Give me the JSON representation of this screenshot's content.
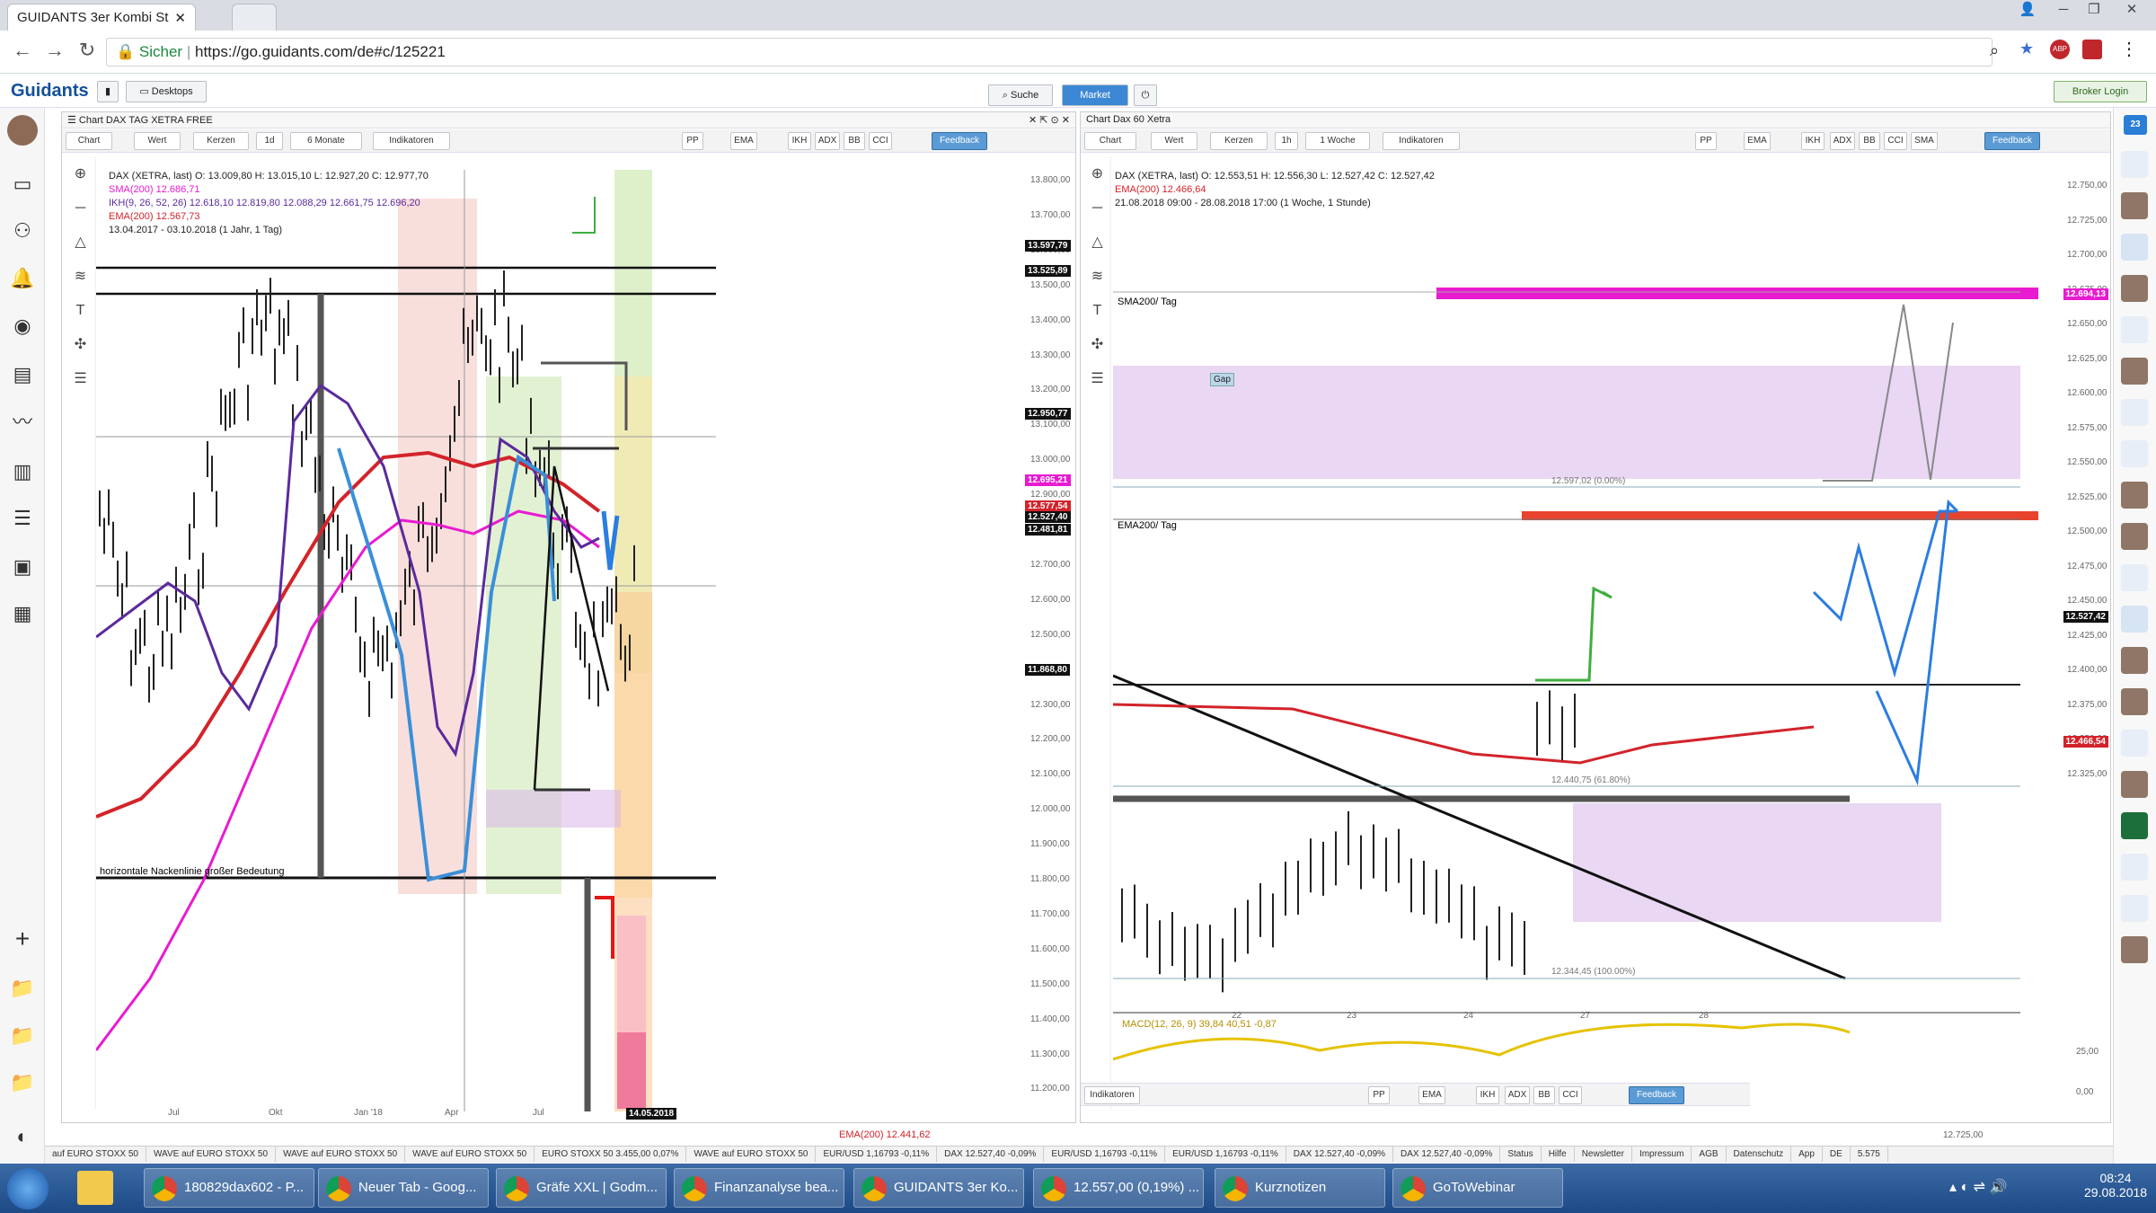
{
  "browser": {
    "tab_title": "GUIDANTS 3er Kombi St",
    "secure_label": "Sicher",
    "url": "https://go.guidants.com/de#c/125221"
  },
  "header": {
    "logo": "Guidants",
    "desktops": "Desktops",
    "search": "Suche",
    "market": "Market",
    "broker_login": "Broker Login"
  },
  "left_chart": {
    "title": "Chart DAX TAG XETRA FREE",
    "toolbar": [
      "Chart",
      "Wert",
      "Kerzen",
      "1d",
      "6 Monate",
      "Indikatoren",
      "PP",
      "EMA",
      "IKH",
      "ADX",
      "BB",
      "CCI",
      "Feedback"
    ],
    "legend": {
      "line1": "DAX (XETRA, last)  O: 13.009,80  H: 13.015,10  L: 12.927,20  C: 12.977,70",
      "sma": "SMA(200)  12.686,71",
      "ikh": "IKH(9, 26, 52, 26)  12.618,10  12.819,80  12.088,29  12.661,75  12.696,20",
      "ema": "EMA(200)  12.567,73",
      "range": "13.04.2017 - 03.10.2018  (1 Jahr, 1 Tag)"
    },
    "price_ticks": [
      "13.800,00",
      "13.700,00",
      "13.600,00",
      "13.500,00",
      "13.400,00",
      "13.300,00",
      "13.200,00",
      "13.100,00",
      "13.000,00",
      "12.900,00",
      "12.800,00",
      "12.700,00",
      "12.600,00",
      "12.500,00",
      "12.400,00",
      "12.300,00",
      "12.200,00",
      "12.100,00",
      "12.000,00",
      "11.900,00",
      "11.800,00",
      "11.700,00",
      "11.600,00",
      "11.500,00",
      "11.400,00",
      "11.300,00",
      "11.200,00"
    ],
    "price_tags": [
      "13.597,79",
      "13.525,89",
      "12.950,77",
      "12.695,21",
      "12.577,54",
      "12.527,40",
      "12.481,81",
      "11.868,80"
    ],
    "x_ticks": [
      "Jul",
      "Okt",
      "Jan '18",
      "Apr",
      "Jul"
    ],
    "date_label": "14.05.2018",
    "annotation": "horizontale Nackenlinie großer Bedeutung",
    "ema_footer": "EMA(200)  12.441,62"
  },
  "right_chart": {
    "title": "Chart Dax 60 Xetra",
    "toolbar": [
      "Chart",
      "Wert",
      "Kerzen",
      "1h",
      "1 Woche",
      "Indikatoren",
      "PP",
      "EMA",
      "IKH",
      "ADX",
      "BB",
      "CCI",
      "SMA",
      "Feedback"
    ],
    "legend": {
      "line1": "DAX (XETRA, last)  O: 12.553,51  H: 12.556,30  L: 12.527,42  C: 12.527,42",
      "ema": "EMA(200)  12.466,64",
      "range": "21.08.2018 09:00 - 28.08.2018 17:00  (1 Woche, 1 Stunde)"
    },
    "price_ticks": [
      "12.750,00",
      "12.725,00",
      "12.700,00",
      "12.675,00",
      "12.650,00",
      "12.625,00",
      "12.600,00",
      "12.575,00",
      "12.550,00",
      "12.525,00",
      "12.500,00",
      "12.475,00",
      "12.450,00",
      "12.425,00",
      "12.400,00",
      "12.375,00",
      "12.350,00",
      "12.325,00"
    ],
    "price_tags": [
      "12.694,13",
      "12.527,42",
      "12.466,54"
    ],
    "labels": {
      "sma": "SMA200/ Tag",
      "ema": "EMA200/ Tag",
      "gap": "Gap",
      "fib0": "12.597,02 (0.00%)",
      "fib1": "12.440,75 (61.80%)",
      "fib100": "12.344,45 (100.00%)"
    },
    "x_ticks": [
      "22",
      "23",
      "24",
      "27",
      "28"
    ],
    "macd": "MACD(12, 26, 9)  39,84  40,51  -0,87",
    "macd_ticks": [
      "25,00",
      "0,00"
    ],
    "bottom_price": "12.725,00",
    "sub_toolbar": [
      "Indikatoren",
      "PP",
      "EMA",
      "IKH",
      "ADX",
      "BB",
      "CCI",
      "Feedback"
    ]
  },
  "statusbar": [
    "auf EURO STOXX 50",
    "WAVE auf EURO STOXX 50",
    "WAVE auf EURO STOXX 50",
    "WAVE auf EURO STOXX 50",
    "EURO STOXX 50 3.455,00 0,07%",
    "WAVE auf EURO STOXX 50",
    "EUR/USD 1,16793 -0,11%",
    "DAX 12.527,40 -0,09%",
    "EUR/USD 1,16793 -0,11%",
    "EUR/USD 1,16793 -0,11%",
    "DAX 12.527,40 -0,09%",
    "DAX 12.527,40 -0,09%",
    "Status",
    "Hilfe",
    "Newsletter",
    "Impressum",
    "AGB",
    "Datenschutz",
    "App",
    "DE",
    "5.575"
  ],
  "taskbar": {
    "items": [
      "180829dax602 - P...",
      "Neuer Tab - Goog...",
      "Gräfe XXL | Godm...",
      "Finanzanalyse bea...",
      "GUIDANTS 3er Ko...",
      "12.557,00 (0,19%) ...",
      "Kurznotizen",
      "GoToWebinar"
    ],
    "time": "08:24",
    "date": "29.08.2018"
  },
  "colors": {
    "sma": "#e81bd0",
    "ema": "#d3232a",
    "ikh": "#5b2a9c",
    "blue": "#3a8fd8",
    "green": "#3fae3f"
  }
}
